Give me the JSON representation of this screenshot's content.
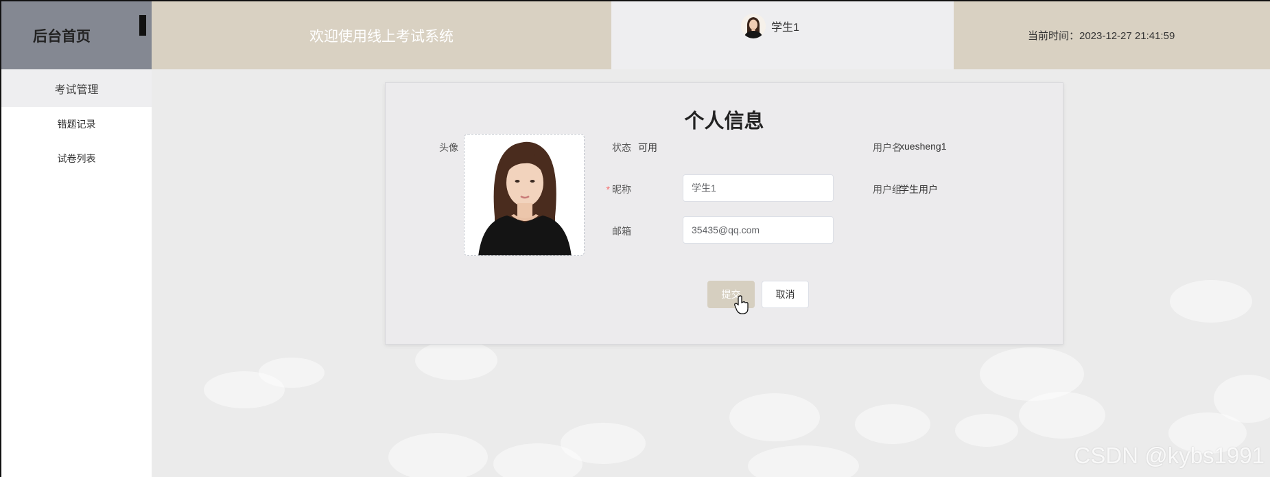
{
  "header": {
    "brand": "后台首页",
    "welcome": "欢迎使用线上考试系统",
    "user_name": "学生1",
    "time": "当前时间：2023-12-27 21:41:59"
  },
  "sidebar": {
    "items": [
      {
        "label": "考试管理",
        "active": true
      },
      {
        "label": "错题记录",
        "active": false
      },
      {
        "label": "试卷列表",
        "active": false
      }
    ]
  },
  "profile": {
    "title": "个人信息",
    "avatar_label": "头像",
    "status_label": "状态",
    "status_value": "可用",
    "username_label": "用户名",
    "username_value": "xuesheng1",
    "nickname_label": "昵称",
    "nickname_value": "学生1",
    "usergroup_label": "用户组",
    "usergroup_value": "学生用户",
    "email_label": "邮箱",
    "email_value": "35435@qq.com",
    "submit_label": "提交",
    "cancel_label": "取消"
  },
  "watermark": "CSDN @kybs1991",
  "colors": {
    "brand_bg": "#848892",
    "header_accent": "#d9d1c2",
    "user_bg": "#eeeef0",
    "main_bg": "#ebebeb",
    "submit_bg": "#d6cfc0"
  }
}
